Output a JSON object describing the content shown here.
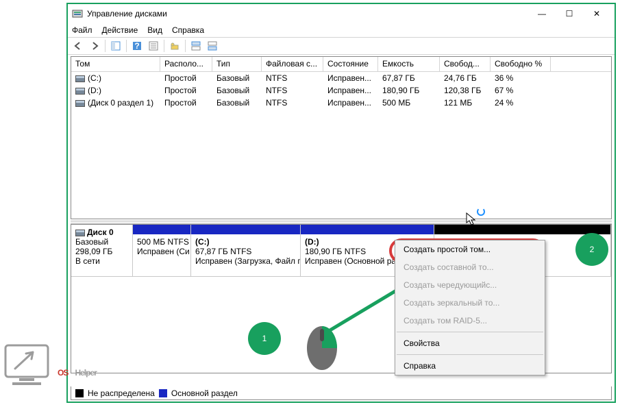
{
  "window": {
    "title": "Управление дисками",
    "menu": {
      "file": "Файл",
      "action": "Действие",
      "view": "Вид",
      "help": "Справка"
    },
    "controls": {
      "min": "—",
      "max": "☐",
      "close": "✕"
    }
  },
  "table": {
    "headers": [
      "Том",
      "Располо...",
      "Тип",
      "Файловая с...",
      "Состояние",
      "Емкость",
      "Свобод...",
      "Свободно %"
    ],
    "rows": [
      {
        "vol": "(C:)",
        "layout": "Простой",
        "type": "Базовый",
        "fs": "NTFS",
        "status": "Исправен...",
        "cap": "67,87 ГБ",
        "free": "24,76 ГБ",
        "pct": "36 %"
      },
      {
        "vol": "(D:)",
        "layout": "Простой",
        "type": "Базовый",
        "fs": "NTFS",
        "status": "Исправен...",
        "cap": "180,90 ГБ",
        "free": "120,38 ГБ",
        "pct": "67 %"
      },
      {
        "vol": "(Диск 0 раздел 1)",
        "layout": "Простой",
        "type": "Базовый",
        "fs": "NTFS",
        "status": "Исправен...",
        "cap": "500 МБ",
        "free": "121 МБ",
        "pct": "24 %"
      }
    ]
  },
  "disk": {
    "label": "Диск 0",
    "type": "Базовый",
    "size": "298,09 ГБ",
    "state": "В сети",
    "parts": [
      {
        "title": "",
        "l1": "500 МБ NTFS",
        "l2": "Исправен (Си"
      },
      {
        "title": "(C:)",
        "l1": "67,87 ГБ NTFS",
        "l2": "Исправен (Загрузка, Файл п"
      },
      {
        "title": "(D:)",
        "l1": "180,90 ГБ NTFS",
        "l2": "Исправен (Основной раздел)"
      },
      {
        "title": "",
        "l1": "",
        "l2": ""
      }
    ]
  },
  "legend": {
    "unalloc": "Не распределена",
    "primary": "Основной раздел"
  },
  "context": {
    "items": [
      {
        "label": "Создать простой том...",
        "enabled": true
      },
      {
        "label": "Создать составной то...",
        "enabled": false
      },
      {
        "label": "Создать чередующийс...",
        "enabled": false
      },
      {
        "label": "Создать зеркальный то...",
        "enabled": false
      },
      {
        "label": "Создать том RAID-5...",
        "enabled": false
      }
    ],
    "props": "Свойства",
    "help": "Справка"
  },
  "annotations": {
    "step1": "1",
    "step2": "2"
  },
  "logo": {
    "part1": "OS",
    "part2": "Helper"
  }
}
